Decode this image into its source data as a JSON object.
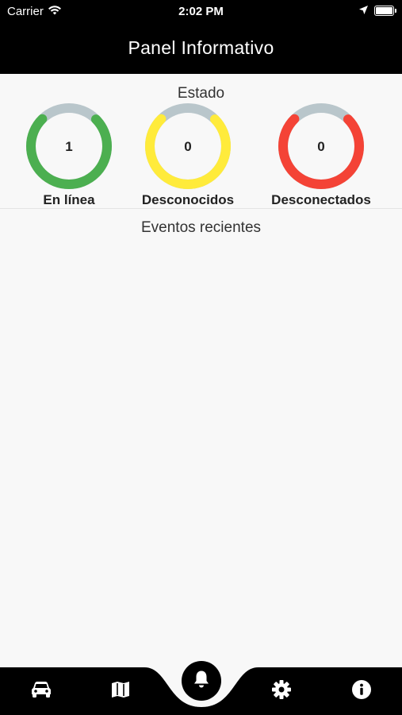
{
  "status_bar": {
    "carrier": "Carrier",
    "time": "2:02 PM"
  },
  "app_bar": {
    "title": "Panel Informativo"
  },
  "status_section": {
    "title": "Estado",
    "gauges": [
      {
        "label": "En línea",
        "value": "1",
        "color": "#4caf50",
        "fraction": 0.75
      },
      {
        "label": "Desconocidos",
        "value": "0",
        "color": "#ffeb3b",
        "fraction": 0.75
      },
      {
        "label": "Desconectados",
        "value": "0",
        "color": "#f44336",
        "fraction": 0.75
      }
    ]
  },
  "events_section": {
    "title": "Eventos recientes",
    "items": []
  },
  "bottom_nav": {
    "items": [
      {
        "name": "car-icon"
      },
      {
        "name": "map-icon"
      },
      {
        "name": "bell-icon",
        "active": true
      },
      {
        "name": "gear-icon"
      },
      {
        "name": "info-icon"
      }
    ]
  },
  "colors": {
    "track": "#b9c6cb",
    "bar": "#000000",
    "background": "#f8f8f8"
  }
}
